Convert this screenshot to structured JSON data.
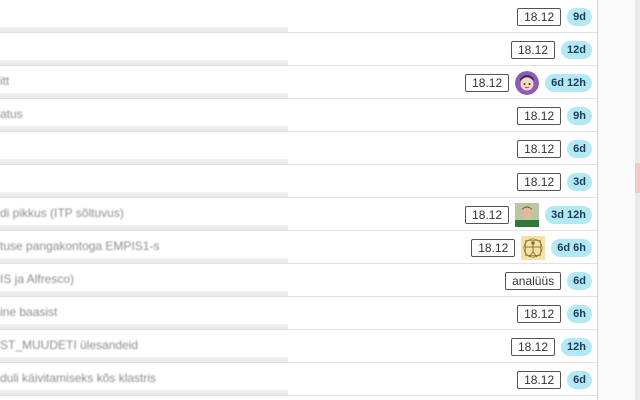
{
  "rows": [
    {
      "title": "",
      "date": "18.12",
      "age": "9d"
    },
    {
      "title": "",
      "date": "18.12",
      "age": "12d"
    },
    {
      "title": "itt",
      "date": "18.12",
      "age": "6d 12h",
      "avatar": "cartoon-user-icon"
    },
    {
      "title": "atus",
      "date": "18.12",
      "age": "9h"
    },
    {
      "title": "",
      "date": "18.12",
      "age": "6d"
    },
    {
      "title": "",
      "date": "18.12",
      "age": "3d"
    },
    {
      "title": "di pikkus (ITP sõltuvus)",
      "date": "18.12",
      "age": "3d 12h",
      "avatar": "photo-user-icon"
    },
    {
      "title": "tuse pangakontoga EMPIS1-s",
      "date": "18.12",
      "age": "6d 6h",
      "avatar": "vitruvian-user-icon"
    },
    {
      "title": "IS ja Alfresco)",
      "date": "analüüs",
      "age": "6d"
    },
    {
      "title": "ine baasist",
      "date": "18.12",
      "age": "6h"
    },
    {
      "title": "ST_MUUDETI ülesandeid",
      "date": "18.12",
      "age": "12h"
    },
    {
      "title": "duli käivitamiseks kõs klastris",
      "date": "18.12",
      "age": "6d"
    }
  ],
  "colors": {
    "age_badge_bg": "#b3e8f5",
    "age_badge_text": "#1d3c55",
    "date_badge_border": "#555555",
    "row_border": "#e3e3e3"
  }
}
